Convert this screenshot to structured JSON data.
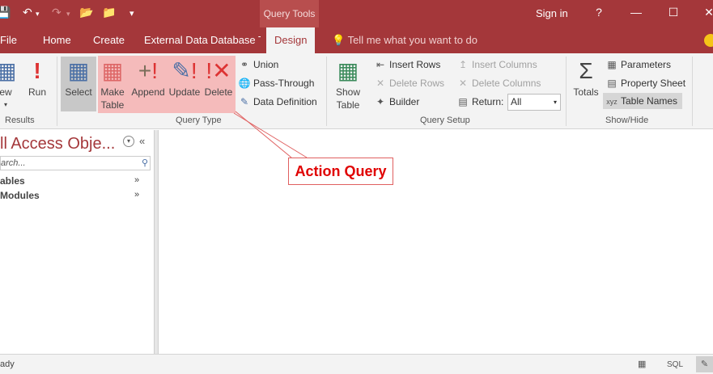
{
  "titlebar": {
    "context_tab": "Query Tools",
    "sign_in": "Sign in",
    "help": "?",
    "qat": {
      "save_icon": "save-icon",
      "undo_icon": "undo-icon",
      "redo_icon": "redo-icon",
      "open_icon": "open-icon",
      "folder_icon": "folder-icon"
    }
  },
  "tabs": {
    "file": "File",
    "home": "Home",
    "create": "Create",
    "external": "External Data",
    "dbtools": "Database Too",
    "design": "Design",
    "tellme": "Tell me what you want to do"
  },
  "ribbon": {
    "results": {
      "label": "Results",
      "view": "ew",
      "run": "Run"
    },
    "query_type": {
      "label": "Query Type",
      "select": "Select",
      "make_table_1": "Make",
      "make_table_2": "Table",
      "append": "Append",
      "update": "Update",
      "delete": "Delete",
      "union": "Union",
      "pass_through": "Pass-Through",
      "data_definition": "Data Definition"
    },
    "query_setup": {
      "label": "Query Setup",
      "show_table_1": "Show",
      "show_table_2": "Table",
      "insert_rows": "Insert Rows",
      "delete_rows": "Delete Rows",
      "builder": "Builder",
      "insert_columns": "Insert Columns",
      "delete_columns": "Delete Columns",
      "return_label": "Return:",
      "return_value": "All"
    },
    "show_hide": {
      "label": "Show/Hide",
      "totals": "Totals",
      "parameters": "Parameters",
      "property_sheet": "Property Sheet",
      "table_names": "Table Names"
    }
  },
  "navpane": {
    "title": "ll Access Obje...",
    "search_placeholder": "arch...",
    "groups": [
      "ables",
      "Modules"
    ]
  },
  "callout": {
    "text": "Action Query"
  },
  "statusbar": {
    "text": "ady",
    "sql": "SQL"
  },
  "colors": {
    "accent": "#a4373a",
    "highlight": "#f5b0b0",
    "callout_text": "#e00000"
  }
}
